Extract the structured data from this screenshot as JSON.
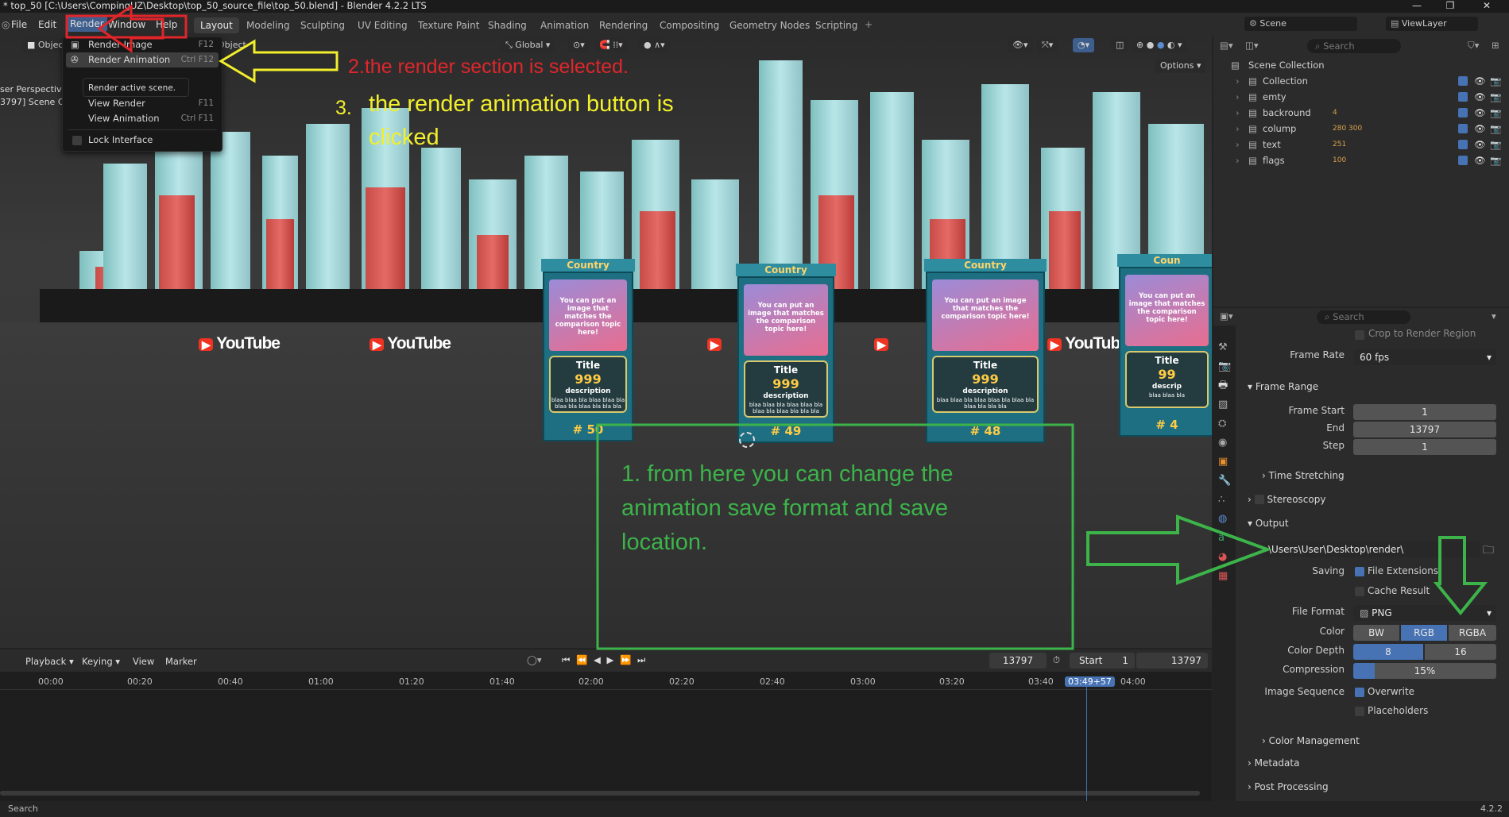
{
  "window": {
    "title": "* top_50 [C:\\Users\\CompingUZ\\Desktop\\top_50_source_file\\top_50.blend] - Blender 4.2.2 LTS",
    "ctl_min": "—",
    "ctl_max": "❐",
    "ctl_close": "✕"
  },
  "menubar": {
    "file": "File",
    "edit": "Edit",
    "render": "Render",
    "window": "Window",
    "help": "Help"
  },
  "workspaces": [
    "Layout",
    "Modeling",
    "Sculpting",
    "UV Editing",
    "Texture Paint",
    "Shading",
    "Animation",
    "Rendering",
    "Compositing",
    "Geometry Nodes",
    "Scripting"
  ],
  "workspace_add": "+",
  "scene": {
    "name": "Scene",
    "viewlayer": "ViewLayer"
  },
  "viewport": {
    "mode": "Object",
    "object_menu": "Object",
    "orientation": "Global",
    "options": "Options",
    "overlay_text_1": "ser Perspective",
    "overlay_text_2": "3797] Scene C",
    "youtube": "YouTube",
    "cards": [
      {
        "country": "Country",
        "top_text": "You can put an image that matches the comparison topic here!",
        "title": "Title",
        "count": "999",
        "desc": "description",
        "desc_text": "blaa blaa bla blaa blaa bla blaa bla blaa bla bla bla",
        "rank": "# 50"
      },
      {
        "country": "Country",
        "top_text": "You can put an image that matches the comparison topic here!",
        "title": "Title",
        "count": "999",
        "desc": "description",
        "desc_text": "blaa blaa bla blaa blaa bla blaa bla blaa bla bla bla",
        "rank": "# 49"
      },
      {
        "country": "Country",
        "top_text": "You can put an image that matches the comparison topic here!",
        "title": "Title",
        "count": "999",
        "desc": "description",
        "desc_text": "blaa blaa bla blaa blaa bla blaa bla blaa bla bla bla",
        "rank": "# 48"
      },
      {
        "country": "Coun",
        "top_text": "You can put an image that matches the comparison topic here!",
        "title": "Title",
        "count": "99",
        "desc": "descrip",
        "desc_text": "blaa blaa bla",
        "rank": "# 4"
      }
    ]
  },
  "render_menu": {
    "items": [
      {
        "label": "Render Image",
        "shortcut": "F12"
      },
      {
        "label": "Render Animation",
        "shortcut": "Ctrl F12"
      },
      {
        "label": "View Render",
        "shortcut": "F11"
      },
      {
        "label": "View Animation",
        "shortcut": "Ctrl F11"
      },
      {
        "label": "Lock Interface",
        "shortcut": ""
      }
    ],
    "tooltip": "Render active scene."
  },
  "annotations": {
    "step2": "2.the render section is selected.",
    "step3_num": "3.",
    "step3": "the render animation button is clicked",
    "step1": "1. from here you can change the animation save format and save location."
  },
  "outliner": {
    "search_placeholder": "Search",
    "root": "Scene Collection",
    "items": [
      {
        "label": "Collection",
        "badge": ""
      },
      {
        "label": "emty",
        "badge": ""
      },
      {
        "label": "backround",
        "badge": "4"
      },
      {
        "label": "colump",
        "badge": "280 300"
      },
      {
        "label": "text",
        "badge": "251"
      },
      {
        "label": "flags",
        "badge": "100"
      }
    ]
  },
  "properties": {
    "search_placeholder": "Search",
    "crop": "Crop to Render Region",
    "frame_rate_label": "Frame Rate",
    "frame_rate": "60 fps",
    "frame_range": "Frame Range",
    "frame_start_label": "Frame Start",
    "frame_start": "1",
    "end_label": "End",
    "end": "13797",
    "step_label": "Step",
    "step": "1",
    "time_stretching": "Time Stretching",
    "stereoscopy": "Stereoscopy",
    "output": "Output",
    "output_path": "\\Users\\User\\Desktop\\render\\",
    "saving_label": "Saving",
    "file_extensions": "File Extensions",
    "cache_result": "Cache Result",
    "file_format_label": "File Format",
    "file_format": "PNG",
    "color_label": "Color",
    "color_opts": [
      "BW",
      "RGB",
      "RGBA"
    ],
    "color_depth_label": "Color Depth",
    "depth_opts": [
      "8",
      "16"
    ],
    "compression_label": "Compression",
    "compression": "15%",
    "compression_value": 0.15,
    "image_sequence_label": "Image Sequence",
    "overwrite": "Overwrite",
    "placeholders": "Placeholders",
    "color_management": "Color Management",
    "metadata": "Metadata",
    "post_processing": "Post Processing"
  },
  "timeline": {
    "playback": "Playback",
    "keying": "Keying",
    "view": "View",
    "marker": "Marker",
    "current_frame": "13797",
    "start_label": "Start",
    "start": "1",
    "end": "13797",
    "ticks": [
      "00:00",
      "00:20",
      "00:40",
      "01:00",
      "01:20",
      "01:40",
      "02:00",
      "02:20",
      "02:40",
      "03:00",
      "03:20",
      "03:40",
      "03:49+57",
      "04:00"
    ]
  },
  "statusbar": {
    "search": "Search",
    "version": "4.2.2"
  },
  "colors": {
    "accent": "#4772b3",
    "red_ann": "#e0262b",
    "yellow_ann": "#f2ef2c",
    "green_ann": "#3cb44a"
  }
}
